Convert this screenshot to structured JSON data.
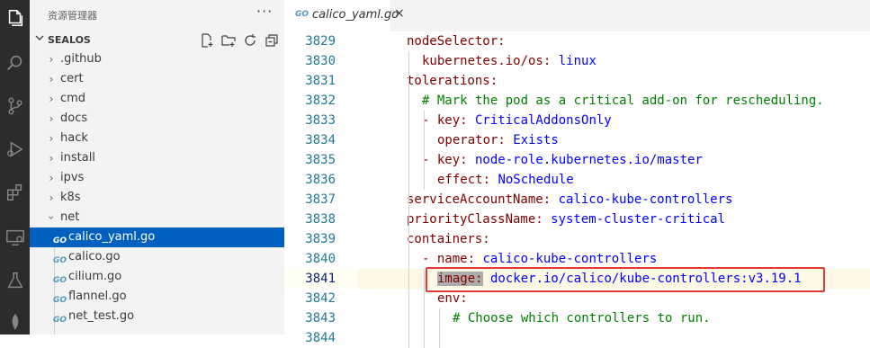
{
  "sidebar": {
    "title": "资源管理器",
    "more": "···",
    "section": "SEALOS",
    "folders": [
      {
        "label": ".github"
      },
      {
        "label": "cert"
      },
      {
        "label": "cmd"
      },
      {
        "label": "docs"
      },
      {
        "label": "hack"
      },
      {
        "label": "install"
      },
      {
        "label": "ipvs"
      },
      {
        "label": "k8s"
      },
      {
        "label": "net"
      }
    ],
    "files": [
      {
        "label": "calico_yaml.go",
        "active": true
      },
      {
        "label": "calico.go"
      },
      {
        "label": "cilium.go"
      },
      {
        "label": "flannel.go"
      },
      {
        "label": "net_test.go"
      }
    ],
    "go_badge": "GO"
  },
  "tab": {
    "label": "calico_yaml.go",
    "close": "×"
  },
  "editor": {
    "lines": [
      {
        "n": "3829",
        "k": "nodeSelector:",
        "v": ""
      },
      {
        "n": "3830",
        "k": "kubernetes.io/os:",
        "v": " linux"
      },
      {
        "n": "3831",
        "k": "tolerations:",
        "v": ""
      },
      {
        "n": "3832",
        "k": "",
        "v": "",
        "c": "# Mark the pod as a critical add-on for rescheduling."
      },
      {
        "n": "3833",
        "k": "- key:",
        "v": " CriticalAddonsOnly"
      },
      {
        "n": "3834",
        "k": "operator:",
        "v": " Exists"
      },
      {
        "n": "3835",
        "k": "- key:",
        "v": " node-role.kubernetes.io/master"
      },
      {
        "n": "3836",
        "k": "effect:",
        "v": " NoSchedule"
      },
      {
        "n": "3837",
        "k": "serviceAccountName:",
        "v": " calico-kube-controllers"
      },
      {
        "n": "3838",
        "k": "priorityClassName:",
        "v": " system-cluster-critical"
      },
      {
        "n": "3839",
        "k": "containers:",
        "v": ""
      },
      {
        "n": "3840",
        "k": "- name:",
        "v": " calico-kube-controllers"
      },
      {
        "n": "3841",
        "k": "image:",
        "v": " docker.io/calico/kube-controllers:v3.19.1",
        "current": true
      },
      {
        "n": "3842",
        "k": "env:",
        "v": ""
      },
      {
        "n": "3843",
        "k": "",
        "v": "",
        "c": "# Choose which controllers to run."
      },
      {
        "n": "3844",
        "k": "",
        "v": ""
      }
    ]
  }
}
